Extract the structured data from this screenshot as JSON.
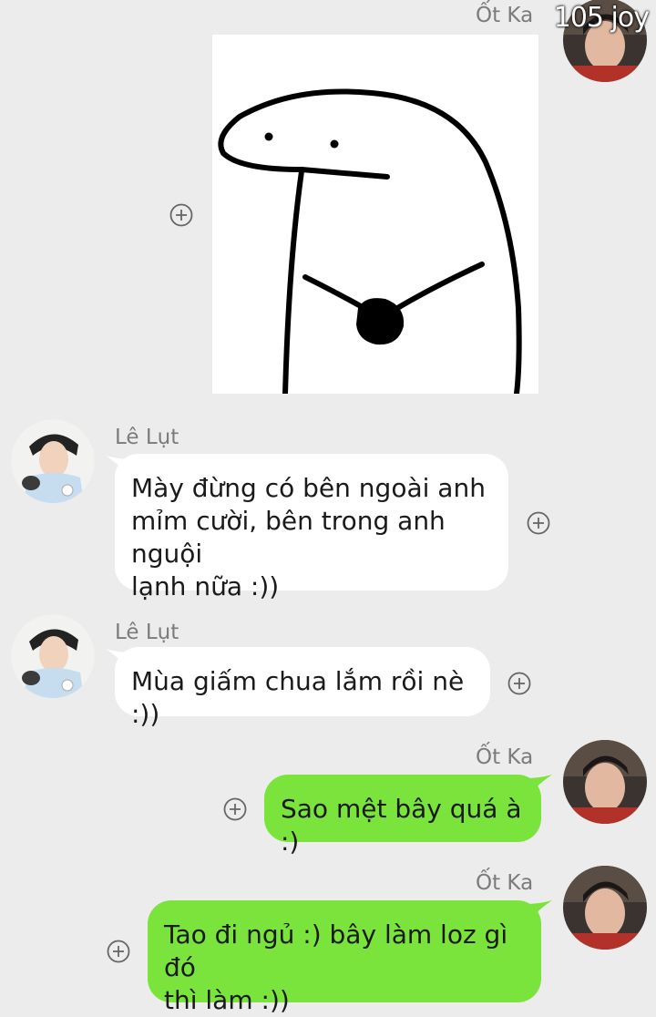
{
  "watermark": "105 joy",
  "messages": [
    {
      "sender": "Ốt Ka",
      "type": "sticker",
      "side": "right",
      "sticker_icon": "drawn-blob-character-sticker"
    },
    {
      "sender": "Lê Lụt",
      "type": "text",
      "side": "left",
      "text_lines": [
        "Mày đừng có bên ngoài anh",
        "mỉm cười, bên trong anh nguội",
        "lạnh nữa :))"
      ]
    },
    {
      "sender": "Lê Lụt",
      "type": "text",
      "side": "left",
      "text_lines": [
        "Mùa giấm chua lắm rồi nè :))"
      ]
    },
    {
      "sender": "Ốt Ka",
      "type": "text",
      "side": "right",
      "text_lines": [
        "Sao mệt bây quá à :)"
      ]
    },
    {
      "sender": "Ốt Ka",
      "type": "text",
      "side": "right",
      "text_lines": [
        "Tao đi ngủ :) bây làm loz gì đó",
        "thì làm :))"
      ]
    }
  ],
  "colors": {
    "background": "#ececec",
    "outgoing_bubble": "#7ae43c",
    "incoming_bubble": "#ffffff",
    "sender_name": "#7b7b7b"
  }
}
